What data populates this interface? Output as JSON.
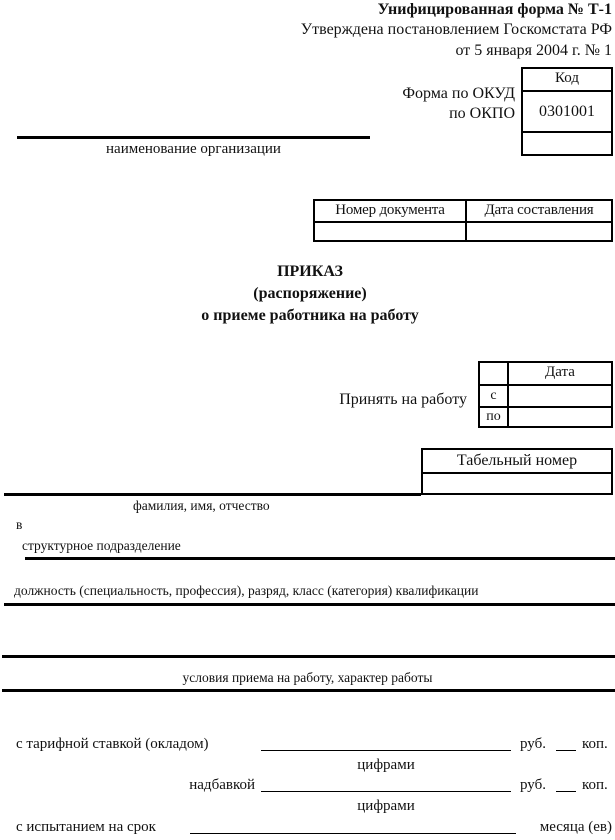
{
  "header": {
    "form_title": "Унифицированная форма № Т-1",
    "approved_by": "Утверждена постановлением Госкомстата РФ",
    "approved_date": "от 5 января 2004 г. № 1"
  },
  "codes": {
    "header": "Код",
    "okud_label": "Форма по ОКУД",
    "okpo_label": "по ОКПО",
    "okud_value": "0301001",
    "okpo_value": ""
  },
  "organization": {
    "caption": "наименование организации",
    "value": ""
  },
  "document_table": {
    "columns": [
      "Номер документа",
      "Дата составления"
    ],
    "values": [
      "",
      ""
    ]
  },
  "title": {
    "line1": "ПРИКАЗ",
    "line2": "(распоряжение)",
    "line3": "о приеме работника на работу"
  },
  "hire": {
    "label": "Принять на работу",
    "date_header": "Дата",
    "from_label": "с",
    "to_label": "по",
    "from_value": "",
    "to_value": ""
  },
  "personnel_number": {
    "header": "Табельный номер",
    "value": ""
  },
  "employee": {
    "fio_caption": "фамилия, имя, отчество",
    "in_label": "в",
    "department_caption": "структурное подразделение",
    "position_caption": "должность (специальность, профессия), разряд, класс (категория) квалификации",
    "conditions_caption": "условия приема на работу, характер работы"
  },
  "salary": {
    "rate_label": "с тарифной ставкой (окладом)",
    "rate_rub_unit": "руб.",
    "rate_kop_unit": "коп.",
    "rate_caption": "цифрами",
    "bonus_label": "надбавкой",
    "bonus_rub_unit": "руб.",
    "bonus_kop_unit": "коп.",
    "bonus_caption": "цифрами",
    "probation_label": "с испытанием на срок",
    "probation_unit": "месяца (ев)"
  }
}
